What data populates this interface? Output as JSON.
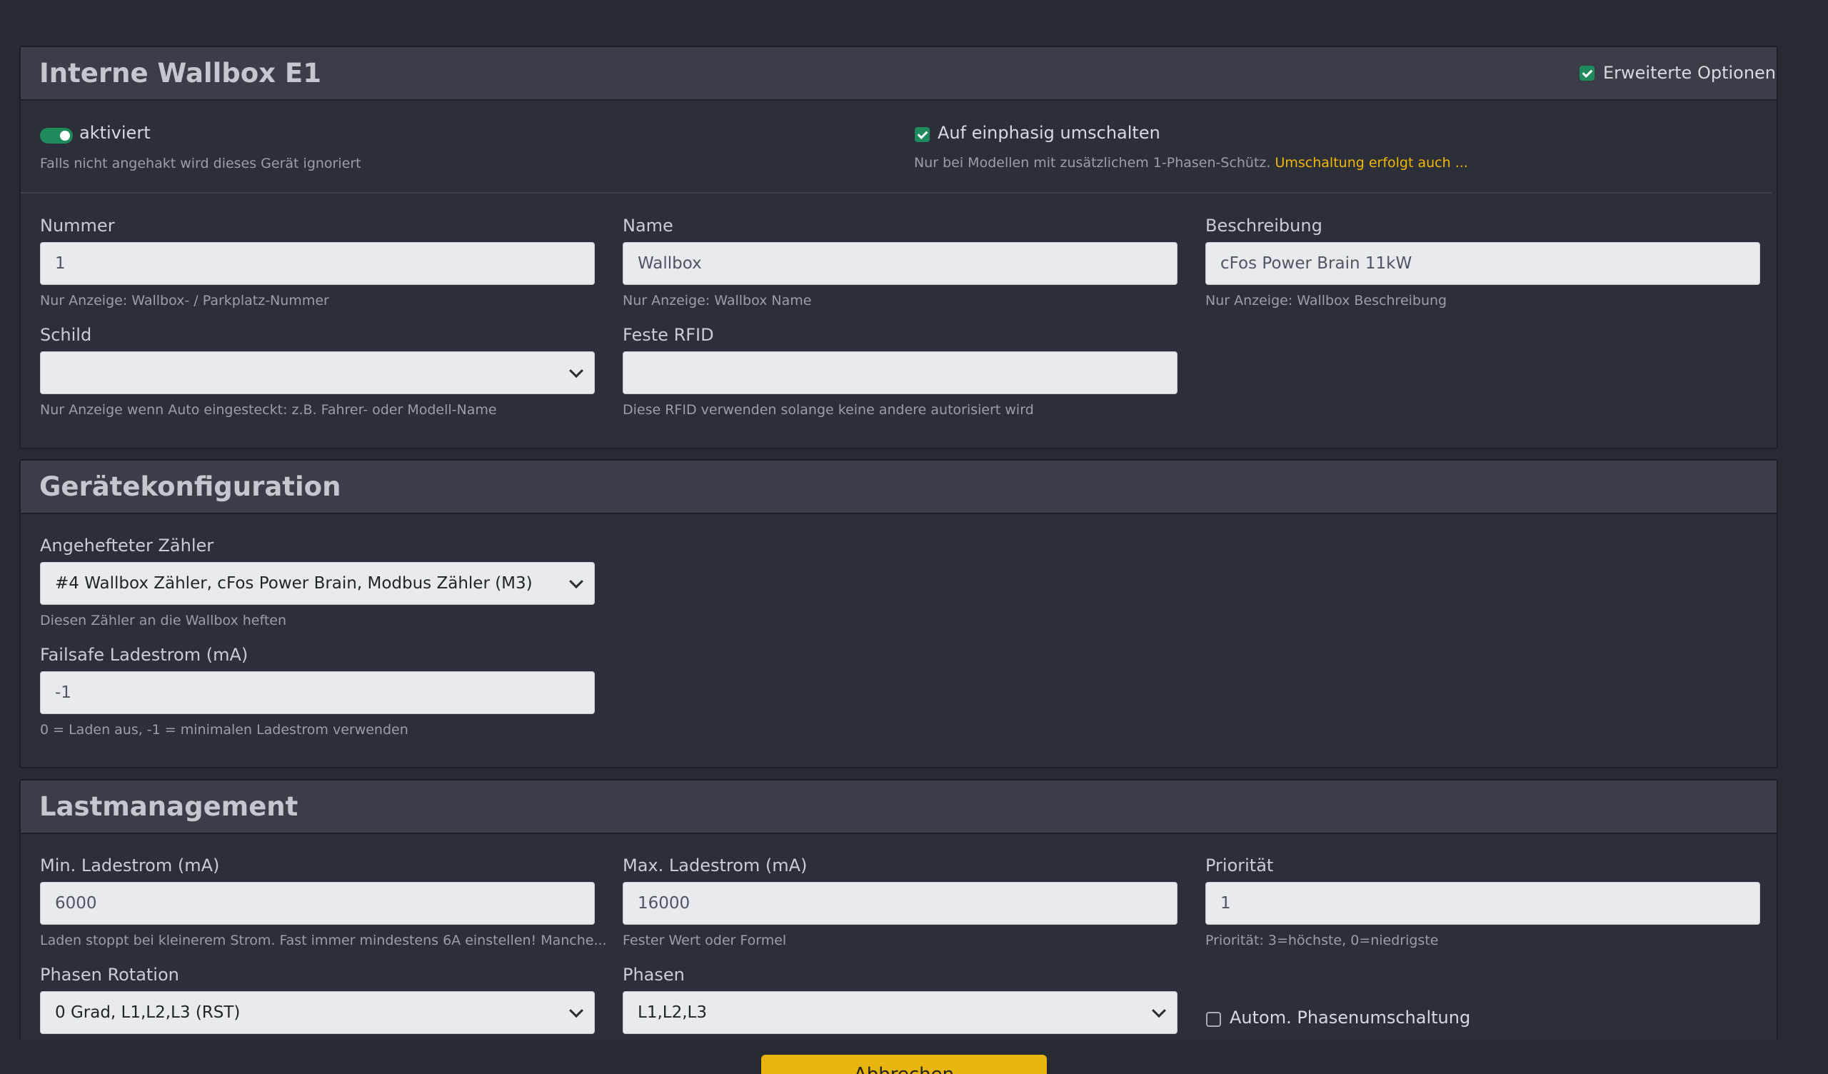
{
  "wallbox_card": {
    "title": "Interne Wallbox E1",
    "advanced_options_label": "Erweiterte Optionen",
    "advanced_options_checked": true,
    "enabled_label": "aktiviert",
    "enabled_hint": "Falls nicht angehakt wird dieses Gerät ignoriert",
    "single_phase_label": "Auf einphasig umschalten",
    "single_phase_checked": true,
    "single_phase_hint": "Nur bei Modellen mit zusätzlichem 1-Phasen-Schütz.",
    "single_phase_hint_warn": "Umschaltung erfolgt auch ...",
    "number": {
      "label": "Nummer",
      "value": "1",
      "hint": "Nur Anzeige: Wallbox- / Parkplatz-Nummer"
    },
    "name": {
      "label": "Name",
      "value": "Wallbox",
      "hint": "Nur Anzeige: Wallbox Name"
    },
    "description": {
      "label": "Beschreibung",
      "value": "cFos Power Brain 11kW",
      "hint": "Nur Anzeige: Wallbox Beschreibung"
    },
    "sign": {
      "label": "Schild",
      "value": "",
      "hint": "Nur Anzeige wenn Auto eingesteckt: z.B. Fahrer- oder Modell-Name"
    },
    "rfid": {
      "label": "Feste RFID",
      "value": "",
      "hint": "Diese RFID verwenden solange keine andere autorisiert wird"
    }
  },
  "device_card": {
    "title": "Gerätekonfiguration",
    "meter": {
      "label": "Angehefteter Zähler",
      "value": "#4 Wallbox Zähler, cFos Power Brain, Modbus Zähler (M3)",
      "hint": "Diesen Zähler an die Wallbox heften"
    },
    "failsafe": {
      "label": "Failsafe Ladestrom (mA)",
      "value": "-1",
      "hint": "0 = Laden aus, -1 = minimalen Ladestrom verwenden"
    }
  },
  "load_card": {
    "title": "Lastmanagement",
    "min_current": {
      "label": "Min. Ladestrom (mA)",
      "value": "6000",
      "hint": "Laden stoppt bei kleinerem Strom. Fast immer mindestens 6A einstellen! Manche..."
    },
    "max_current": {
      "label": "Max. Ladestrom (mA)",
      "value": "16000",
      "hint": "Fester Wert oder Formel"
    },
    "priority": {
      "label": "Priorität",
      "value": "1",
      "hint": "Priorität: 3=höchste, 0=niedrigste"
    },
    "phase_rotation": {
      "label": "Phasen Rotation",
      "value": "0 Grad, L1,L2,L3 (RST)"
    },
    "phases": {
      "label": "Phasen",
      "value": "L1,L2,L3"
    },
    "auto_phase_label": "Autom. Phasenumschaltung",
    "auto_phase_checked": false
  },
  "footer": {
    "button_label": "Abbrechen"
  },
  "colors": {
    "accent_green": "#1f8a5b",
    "warn_yellow": "#f0b800",
    "button_yellow": "#e8b50e"
  }
}
